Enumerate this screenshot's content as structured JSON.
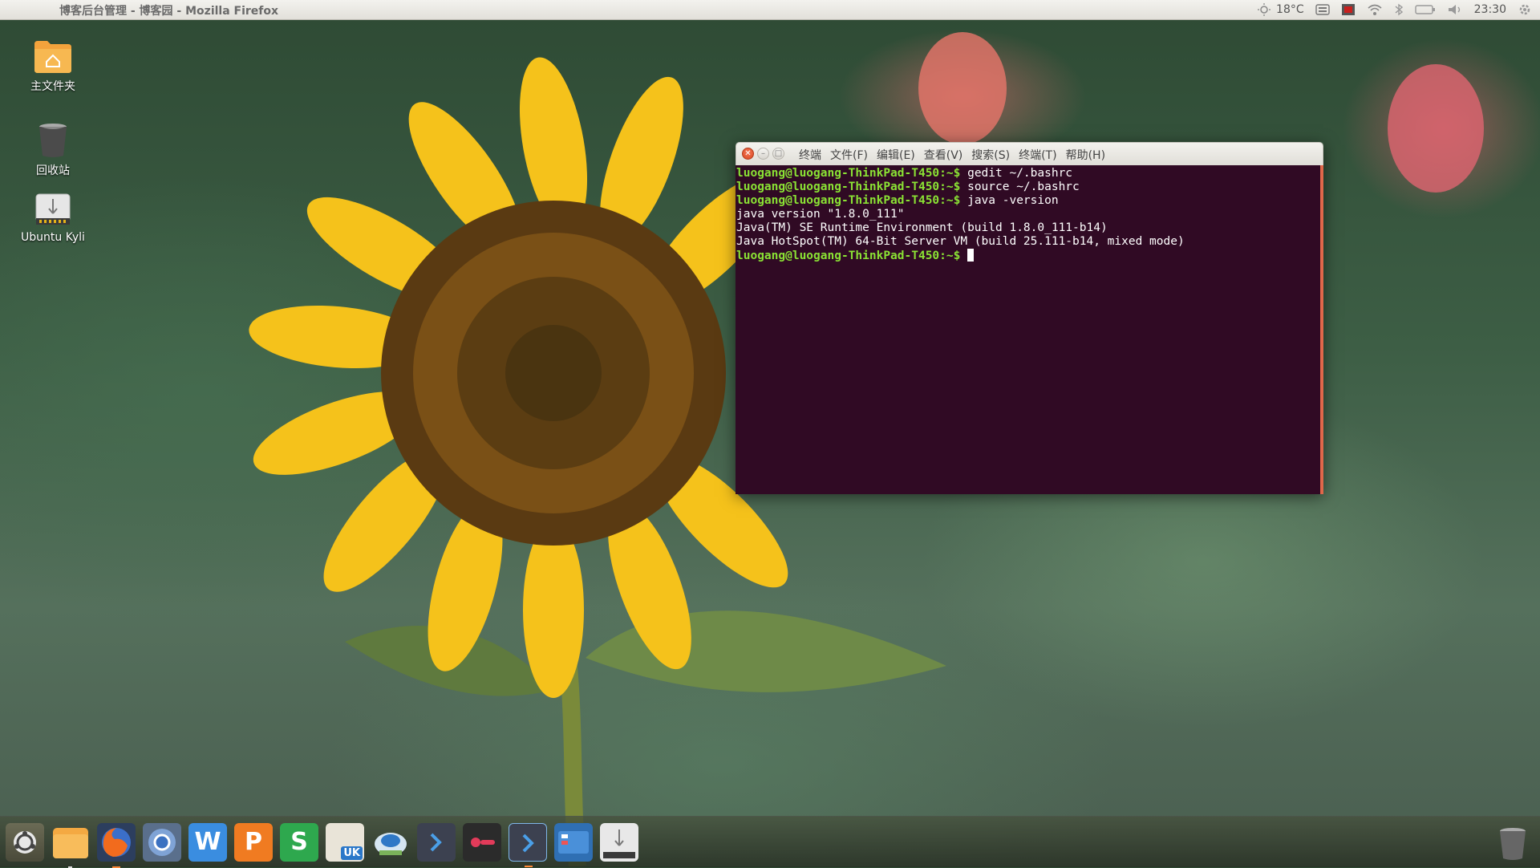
{
  "top_panel": {
    "window_title": "博客后台管理 - 博客园 - Mozilla Firefox",
    "weather": "18°C",
    "clock": "23:30",
    "icons": [
      "weather-icon",
      "keyboard-icon",
      "record-icon",
      "wifi-icon",
      "bluetooth-icon",
      "battery-icon",
      "volume-icon",
      "gear-icon"
    ]
  },
  "desktop_icons": [
    {
      "label": "主文件夹",
      "icon": "home-folder-icon"
    },
    {
      "label": "回收站",
      "icon": "trash-icon"
    },
    {
      "label": "Ubuntu Kyli",
      "icon": "usb-drive-icon"
    }
  ],
  "terminal": {
    "menu": [
      "终端",
      "文件(F)",
      "编辑(E)",
      "查看(V)",
      "搜索(S)",
      "终端(T)",
      "帮助(H)"
    ],
    "prompt": "luogang@luogang-ThinkPad-T450:~$",
    "lines": [
      {
        "type": "cmd",
        "text": " gedit ~/.bashrc"
      },
      {
        "type": "cmd",
        "text": " source ~/.bashrc"
      },
      {
        "type": "cmd",
        "text": " java -version"
      },
      {
        "type": "out",
        "text": "java version \"1.8.0_111\""
      },
      {
        "type": "out",
        "text": "Java(TM) SE Runtime Environment (build 1.8.0_111-b14)"
      },
      {
        "type": "out",
        "text": "Java HotSpot(TM) 64-Bit Server VM (build 25.111-b14, mixed mode)"
      },
      {
        "type": "cmd",
        "text": " "
      }
    ]
  },
  "dock": {
    "items": [
      {
        "name": "dock-item-ubuntu-kylin",
        "icon": "ubuntu-kylin-logo-icon"
      },
      {
        "name": "dock-item-files",
        "icon": "files-icon"
      },
      {
        "name": "dock-item-firefox",
        "icon": "firefox-icon"
      },
      {
        "name": "dock-item-chromium",
        "icon": "chromium-icon"
      },
      {
        "name": "dock-item-wps-writer",
        "icon": "wps-writer-icon",
        "letter": "W"
      },
      {
        "name": "dock-item-wps-presentation",
        "icon": "wps-presentation-icon",
        "letter": "P"
      },
      {
        "name": "dock-item-wps-spreadsheets",
        "icon": "wps-spreadsheets-icon",
        "letter": "S"
      },
      {
        "name": "dock-item-software-center",
        "icon": "software-center-icon",
        "letter": "UK"
      },
      {
        "name": "dock-item-screenshot",
        "icon": "screenshot-icon"
      },
      {
        "name": "dock-item-terminal-1",
        "icon": "terminal-icon"
      },
      {
        "name": "dock-item-recorder",
        "icon": "recorder-icon"
      },
      {
        "name": "dock-item-terminal-2",
        "icon": "terminal-icon"
      },
      {
        "name": "dock-item-workspace",
        "icon": "workspace-switcher-icon"
      },
      {
        "name": "dock-item-usb",
        "icon": "usb-drive-icon"
      },
      {
        "name": "dock-item-trash",
        "icon": "trash-icon"
      }
    ]
  },
  "colors": {
    "terminal_bg": "#300a24",
    "prompt_green": "#8ae234",
    "accent_orange": "#e0674a"
  }
}
